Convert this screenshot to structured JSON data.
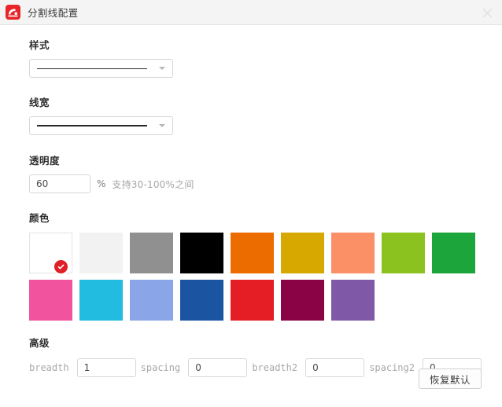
{
  "window": {
    "title": "分割线配置",
    "app_icon": "divider-app-icon",
    "close_icon": "close-icon",
    "accent_color": "#e8262a"
  },
  "style_section": {
    "label": "样式",
    "selected_preview": "solid-thin-line",
    "caret_icon": "chevron-down-icon"
  },
  "linewidth_section": {
    "label": "线宽",
    "selected_preview": "solid-thick-line",
    "caret_icon": "chevron-down-icon"
  },
  "opacity_section": {
    "label": "透明度",
    "value": "60",
    "placeholder": "",
    "unit": "%",
    "hint": "支持30-100%之间"
  },
  "color_section": {
    "label": "颜色",
    "selected_index": 0,
    "check_icon": "check-circle-icon",
    "swatches": [
      {
        "name": "white",
        "hex": "#ffffff",
        "bordered": true
      },
      {
        "name": "off-white",
        "hex": "#f2f2f2",
        "bordered": false
      },
      {
        "name": "gray",
        "hex": "#909090",
        "bordered": false
      },
      {
        "name": "black",
        "hex": "#000000",
        "bordered": false
      },
      {
        "name": "orange",
        "hex": "#ed6c00",
        "bordered": false
      },
      {
        "name": "gold",
        "hex": "#d6a800",
        "bordered": false
      },
      {
        "name": "salmon",
        "hex": "#fb9066",
        "bordered": false
      },
      {
        "name": "yellow-green",
        "hex": "#8cc220",
        "bordered": false
      },
      {
        "name": "green",
        "hex": "#1ba53b",
        "bordered": false
      },
      {
        "name": "pink",
        "hex": "#f2539e",
        "bordered": false
      },
      {
        "name": "cyan",
        "hex": "#21bce0",
        "bordered": false
      },
      {
        "name": "light-blue",
        "hex": "#8aa5e8",
        "bordered": false
      },
      {
        "name": "dark-blue",
        "hex": "#1b54a0",
        "bordered": false
      },
      {
        "name": "red",
        "hex": "#e51d24",
        "bordered": false
      },
      {
        "name": "dark-magenta",
        "hex": "#8a0344",
        "bordered": false
      },
      {
        "name": "purple",
        "hex": "#8058a8",
        "bordered": false
      }
    ]
  },
  "advanced_section": {
    "label": "高级",
    "fields": [
      {
        "label": "breadth",
        "value": "1"
      },
      {
        "label": "spacing",
        "value": "0"
      },
      {
        "label": "breadth2",
        "value": "0"
      },
      {
        "label": "spacing2",
        "value": "0"
      }
    ]
  },
  "footer": {
    "reset_label": "恢复默认"
  }
}
